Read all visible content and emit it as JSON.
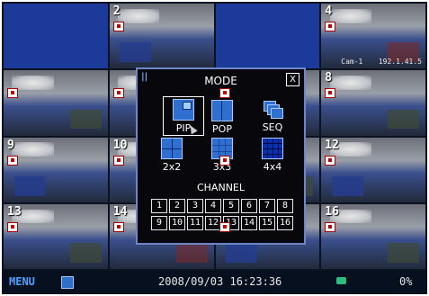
{
  "tiles": [
    {
      "label": "",
      "kind": "blue",
      "rec": false,
      "name": "",
      "info": ""
    },
    {
      "label": "2",
      "kind": "cam v2",
      "rec": true,
      "name": "",
      "info": ""
    },
    {
      "label": "",
      "kind": "blue",
      "rec": false,
      "name": "",
      "info": ""
    },
    {
      "label": "4",
      "kind": "cam",
      "rec": true,
      "name": "Cam-1",
      "info": "192.1.41.5"
    },
    {
      "label": "",
      "kind": "cam v3",
      "rec": true,
      "name": "",
      "info": ""
    },
    {
      "label": "",
      "kind": "cam",
      "rec": true,
      "name": "",
      "info": ""
    },
    {
      "label": "",
      "kind": "cam v2",
      "rec": true,
      "name": "",
      "info": ""
    },
    {
      "label": "8",
      "kind": "cam v3",
      "rec": true,
      "name": "",
      "info": ""
    },
    {
      "label": "9",
      "kind": "cam v2",
      "rec": true,
      "name": "",
      "info": ""
    },
    {
      "label": "10",
      "kind": "cam",
      "rec": true,
      "name": "",
      "info": ""
    },
    {
      "label": "",
      "kind": "cam v3",
      "rec": true,
      "name": "",
      "info": ""
    },
    {
      "label": "12",
      "kind": "cam v2",
      "rec": true,
      "name": "",
      "info": ""
    },
    {
      "label": "13",
      "kind": "cam v3",
      "rec": true,
      "name": "",
      "info": ""
    },
    {
      "label": "14",
      "kind": "cam",
      "rec": true,
      "name": "",
      "info": ""
    },
    {
      "label": "",
      "kind": "cam v2",
      "rec": true,
      "name": "",
      "info": ""
    },
    {
      "label": "16",
      "kind": "cam v3",
      "rec": true,
      "name": "",
      "info": ""
    }
  ],
  "statusbar": {
    "menu_label": "MENU",
    "datetime": "2008/09/03 16:23:36",
    "hdd_percent": "0%"
  },
  "dialog": {
    "pause_glyph": "||",
    "title": "MODE",
    "close_label": "X",
    "modes": [
      {
        "id": "pip",
        "label": "PIP",
        "icon": "pip-icon"
      },
      {
        "id": "pop",
        "label": "POP",
        "icon": "pop-icon"
      },
      {
        "id": "seq",
        "label": "SEQ",
        "icon": "seq-icon"
      },
      {
        "id": "grid2",
        "label": "2x2",
        "icon": "grid-2x2-icon"
      },
      {
        "id": "grid3",
        "label": "3x3",
        "icon": "grid-3x3-icon"
      },
      {
        "id": "grid4",
        "label": "4x4",
        "icon": "grid-4x4-icon"
      }
    ],
    "channel_label": "CHANNEL",
    "channels": [
      "1",
      "2",
      "3",
      "4",
      "5",
      "6",
      "7",
      "8",
      "9",
      "10",
      "11",
      "12",
      "13",
      "14",
      "15",
      "16"
    ]
  }
}
